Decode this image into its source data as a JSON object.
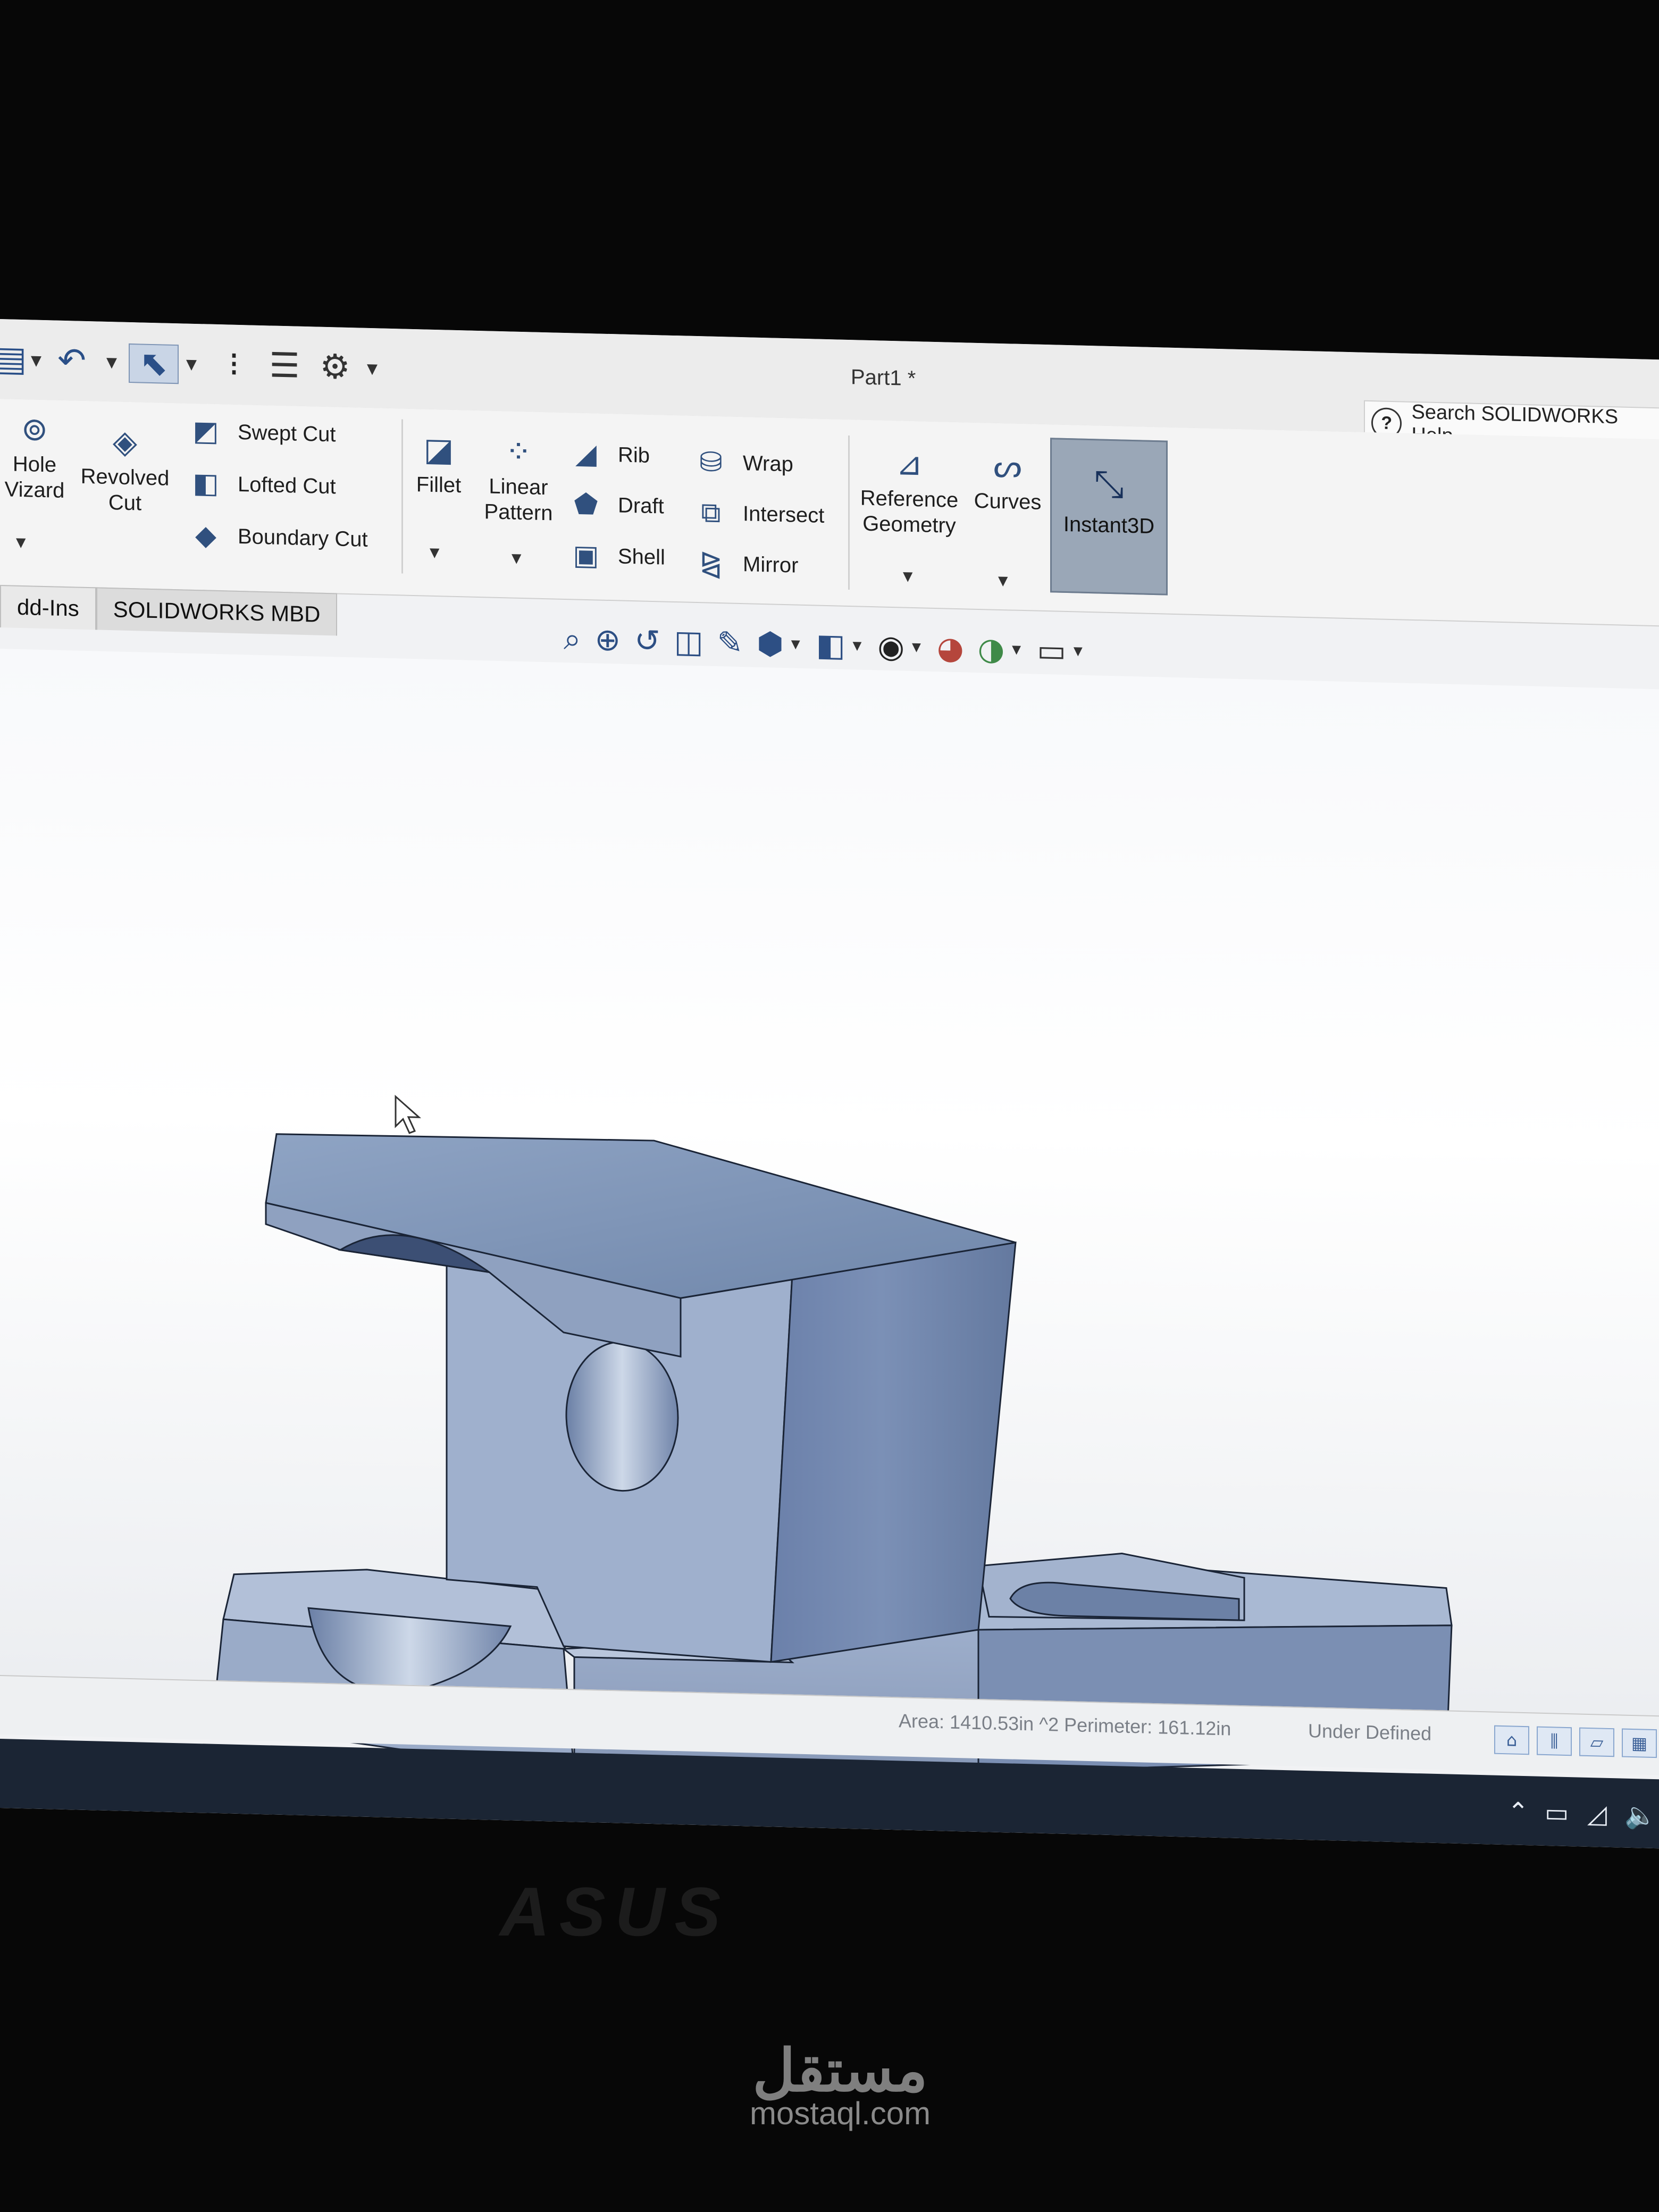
{
  "window": {
    "title": "Part1 *"
  },
  "quick_access": {
    "icons": [
      "print-icon",
      "undo-icon",
      "select-arrow-icon",
      "traffic-light-icon",
      "file-properties-icon",
      "options-gear-icon"
    ]
  },
  "search": {
    "label": "Search SOLIDWORKS Help"
  },
  "ribbon": {
    "hole_wizard": "Hole\nWizard",
    "hole_wizard_l1": "Hole",
    "hole_wizard_l2": "Vizard",
    "revolved_cut_l1": "Revolved",
    "revolved_cut_l2": "Cut",
    "swept_cut": "Swept Cut",
    "lofted_cut": "Lofted Cut",
    "boundary_cut": "Boundary Cut",
    "fillet": "Fillet",
    "linear_pattern_l1": "Linear",
    "linear_pattern_l2": "Pattern",
    "rib": "Rib",
    "draft": "Draft",
    "shell": "Shell",
    "wrap": "Wrap",
    "intersect": "Intersect",
    "mirror": "Mirror",
    "reference_geometry_l1": "Reference",
    "reference_geometry_l2": "Geometry",
    "curves": "Curves",
    "instant3d": "Instant3D"
  },
  "tabs": [
    "dd-Ins",
    "SOLIDWORKS MBD"
  ],
  "status": {
    "measure": "Area: 1410.53in ^2 Perimeter: 161.12in",
    "state": "Under Defined"
  },
  "colors": {
    "model_face_light": "#aebcd4",
    "model_face_mid": "#8e9fba",
    "model_face_dark": "#5f7398",
    "taskbar": "#1b2534"
  },
  "monitor_brand": "ASUS",
  "watermark": {
    "logo": "مستقل",
    "text": "mostaql.com"
  }
}
